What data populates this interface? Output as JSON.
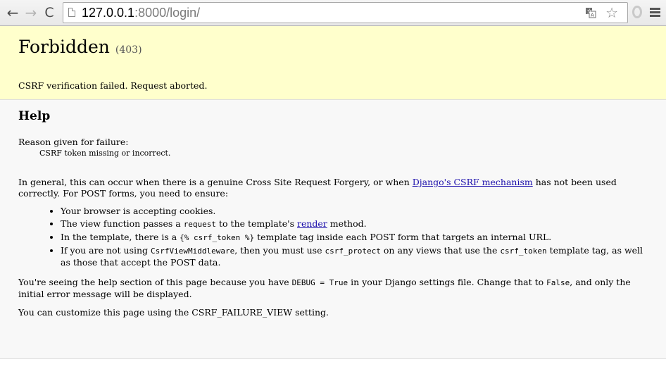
{
  "browser": {
    "back_glyph": "←",
    "forward_glyph": "→",
    "reload_glyph": "C",
    "url_host": "127.0.0.1",
    "url_rest": ":8000/login/",
    "star_glyph": "☆"
  },
  "page": {
    "title": "Forbidden",
    "status_code": "(403)",
    "summary": "CSRF verification failed. Request aborted.",
    "help_heading": "Help",
    "reason_label": "Reason given for failure:",
    "reason": "CSRF token missing or incorrect.",
    "intro_before_link": "In general, this can occur when there is a genuine Cross Site Request Forgery, or when ",
    "intro_link": "Django's CSRF mechanism",
    "intro_after_link": " has not been used correctly. For POST forms, you need to ensure:",
    "bullets": {
      "b1": "Your browser is accepting cookies.",
      "b2_before": "The view function passes a ",
      "b2_code": "request",
      "b2_mid": " to the template's ",
      "b2_link": "render",
      "b2_after": " method.",
      "b3_before": "In the template, there is a ",
      "b3_code": "{% csrf_token %}",
      "b3_after": " template tag inside each POST form that targets an internal URL.",
      "b4_before": "If you are not using ",
      "b4_code1": "CsrfViewMiddleware",
      "b4_mid1": ", then you must use ",
      "b4_code2": "csrf_protect",
      "b4_mid2": " on any views that use the ",
      "b4_code3": "csrf_token",
      "b4_after": " template tag, as well as those that accept the POST data."
    },
    "debug_before": "You're seeing the help section of this page because you have ",
    "debug_code1": "DEBUG = True",
    "debug_mid": " in your Django settings file. Change that to ",
    "debug_code2": "False",
    "debug_after": ", and only the initial error message will be displayed.",
    "customize": "You can customize this page using the CSRF_FAILURE_VIEW setting."
  }
}
